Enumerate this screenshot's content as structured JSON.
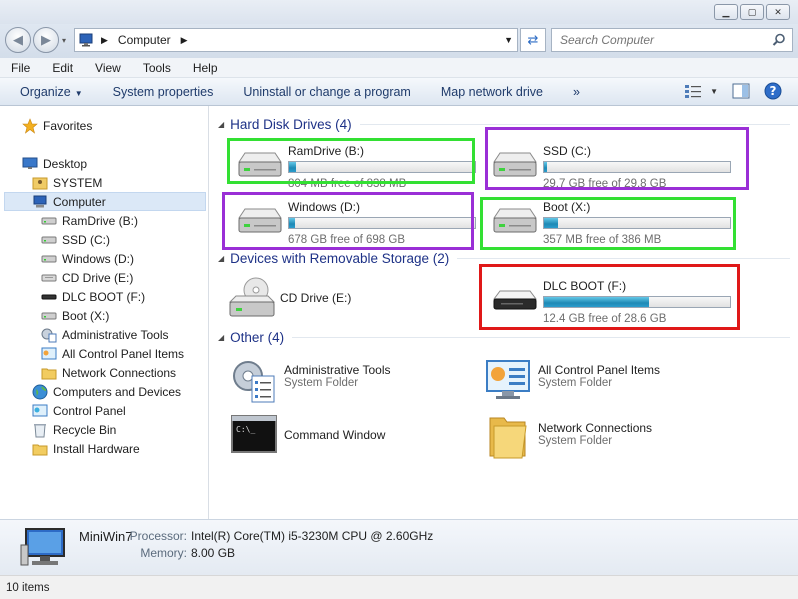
{
  "address": {
    "crumb": "Computer"
  },
  "search": {
    "placeholder": "Search Computer"
  },
  "menu": [
    "File",
    "Edit",
    "View",
    "Tools",
    "Help"
  ],
  "commands": {
    "organize": "Organize",
    "system_properties": "System properties",
    "uninstall": "Uninstall or change a program",
    "map_drive": "Map network drive",
    "more": "»"
  },
  "nav": {
    "favorites": "Favorites",
    "desktop": "Desktop",
    "system": "SYSTEM",
    "computer": "Computer",
    "ramdrive": "RamDrive (B:)",
    "ssd": "SSD (C:)",
    "windows": "Windows (D:)",
    "cddrive": "CD Drive (E:)",
    "dlcboot": "DLC BOOT (F:)",
    "boot": "Boot (X:)",
    "admintools": "Administrative Tools",
    "controlpanelitems": "All Control Panel Items",
    "netconn": "Network Connections",
    "computers_devices": "Computers and Devices",
    "controlpanel": "Control Panel",
    "recyclebin": "Recycle Bin",
    "installhw": "Install Hardware"
  },
  "groups": {
    "hdd": "Hard Disk Drives (4)",
    "removable": "Devices with Removable Storage (2)",
    "other": "Other (4)"
  },
  "drives": {
    "ramdrive": {
      "name": "RamDrive (B:)",
      "free": "804 MB free of 838 MB",
      "used_fraction": 0.04
    },
    "ssd": {
      "name": "SSD (C:)",
      "free": "29.7 GB free of 29.8 GB",
      "used_fraction": 0.004
    },
    "windows": {
      "name": "Windows (D:)",
      "free": "678 GB free of 698 GB",
      "used_fraction": 0.03
    },
    "boot": {
      "name": "Boot (X:)",
      "free": "357 MB free of 386 MB",
      "used_fraction": 0.075
    },
    "dlcboot": {
      "name": "DLC BOOT (F:)",
      "free": "12.4 GB free of 28.6 GB",
      "used_fraction": 0.566
    }
  },
  "devices": {
    "cddrive": {
      "name": "CD Drive (E:)"
    }
  },
  "other": {
    "admintools": {
      "name": "Administrative Tools",
      "sub": "System Folder"
    },
    "controlpanelitems": {
      "name": "All Control Panel Items",
      "sub": "System Folder"
    },
    "cmdwindow": {
      "name": "Command Window"
    },
    "netconn": {
      "name": "Network Connections",
      "sub": "System Folder"
    }
  },
  "details": {
    "name": "MiniWin7",
    "processor_label": "Processor:",
    "processor": "Intel(R) Core(TM) i5-3230M CPU @ 2.60GHz",
    "memory_label": "Memory:",
    "memory": "8.00 GB"
  },
  "status": {
    "count": "10 items"
  },
  "colors": {
    "highlight_green": "#33e033",
    "highlight_purple": "#9a2fd6",
    "highlight_red": "#e01818",
    "bar_fill": "#1e89b5",
    "group_text": "#1e3287"
  }
}
